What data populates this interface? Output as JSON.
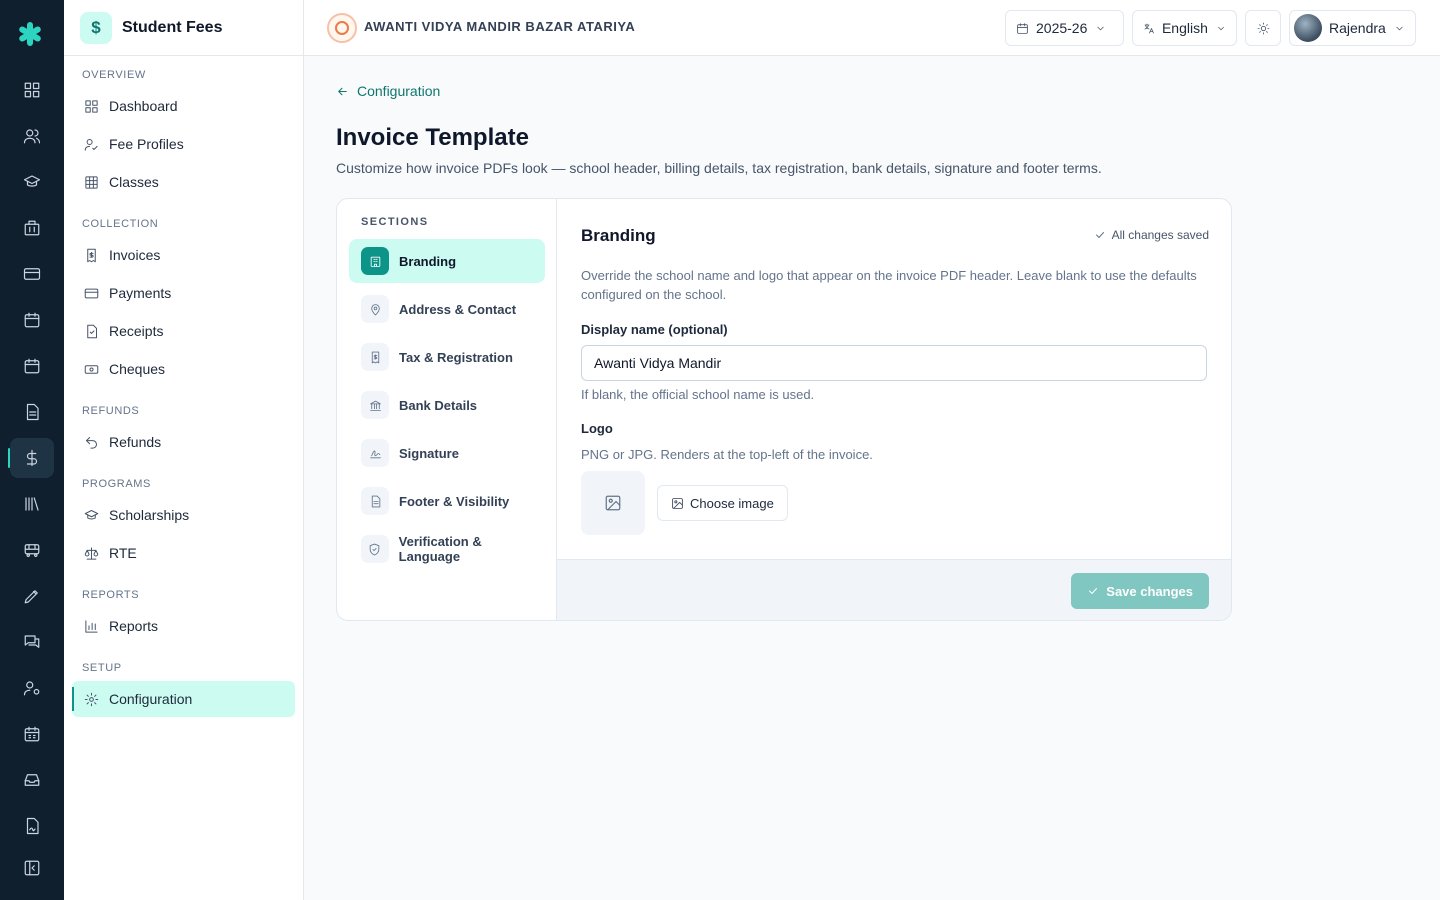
{
  "app": {
    "module_title": "Student Fees",
    "module_icon": "$"
  },
  "rail": {
    "icons": [
      "dashboard-icon",
      "users-icon",
      "graduation-cap-icon",
      "building-icon",
      "card-icon",
      "calendar-icon",
      "calendar-icon",
      "document-icon",
      "dollar-icon",
      "library-icon",
      "bus-icon",
      "pen-icon",
      "messages-icon",
      "user-cog-icon",
      "calendar-grid-icon",
      "inbox-icon",
      "file-signature-icon",
      "collapse-icon"
    ],
    "active": "dollar-icon"
  },
  "sidebar": {
    "sections": [
      {
        "label": "OVERVIEW",
        "items": [
          {
            "label": "Dashboard",
            "icon": "dashboard-icon"
          },
          {
            "label": "Fee Profiles",
            "icon": "user-check-icon"
          },
          {
            "label": "Classes",
            "icon": "grid-icon"
          }
        ]
      },
      {
        "label": "COLLECTION",
        "items": [
          {
            "label": "Invoices",
            "icon": "invoice-icon"
          },
          {
            "label": "Payments",
            "icon": "card-icon"
          },
          {
            "label": "Receipts",
            "icon": "receipt-icon"
          },
          {
            "label": "Cheques",
            "icon": "cheque-icon"
          }
        ]
      },
      {
        "label": "REFUNDS",
        "items": [
          {
            "label": "Refunds",
            "icon": "undo-icon"
          }
        ]
      },
      {
        "label": "PROGRAMS",
        "items": [
          {
            "label": "Scholarships",
            "icon": "graduation-cap-icon"
          },
          {
            "label": "RTE",
            "icon": "scale-icon"
          }
        ]
      },
      {
        "label": "REPORTS",
        "items": [
          {
            "label": "Reports",
            "icon": "bar-chart-icon"
          }
        ]
      },
      {
        "label": "SETUP",
        "items": [
          {
            "label": "Configuration",
            "icon": "gear-icon",
            "active": true
          }
        ]
      }
    ]
  },
  "topbar": {
    "school_name": "AWANTI VIDYA MANDIR BAZAR ATARIYA",
    "year": "2025-26",
    "language": "English",
    "user": "Rajendra"
  },
  "page": {
    "back_label": "Configuration",
    "title": "Invoice Template",
    "subtitle": "Customize how invoice PDFs look — school header, billing details, tax registration, bank details, signature and footer terms."
  },
  "sections_nav": {
    "heading": "SECTIONS",
    "items": [
      {
        "label": "Branding",
        "icon": "building-icon",
        "active": true
      },
      {
        "label": "Address & Contact",
        "icon": "map-pin-icon"
      },
      {
        "label": "Tax & Registration",
        "icon": "receipt-icon"
      },
      {
        "label": "Bank Details",
        "icon": "bank-icon"
      },
      {
        "label": "Signature",
        "icon": "signature-icon"
      },
      {
        "label": "Footer & Visibility",
        "icon": "document-icon"
      },
      {
        "label": "Verification & Language",
        "icon": "shield-check-icon"
      }
    ]
  },
  "branding": {
    "title": "Branding",
    "status": "All changes saved",
    "description": "Override the school name and logo that appear on the invoice PDF header. Leave blank to use the defaults configured on the school.",
    "display_name_label": "Display name (optional)",
    "display_name_value": "Awanti Vidya Mandir",
    "display_name_hint": "If blank, the official school name is used.",
    "logo_label": "Logo",
    "logo_hint": "PNG or JPG. Renders at the top-left of the invoice.",
    "choose_image_label": "Choose image",
    "save_label": "Save changes"
  }
}
